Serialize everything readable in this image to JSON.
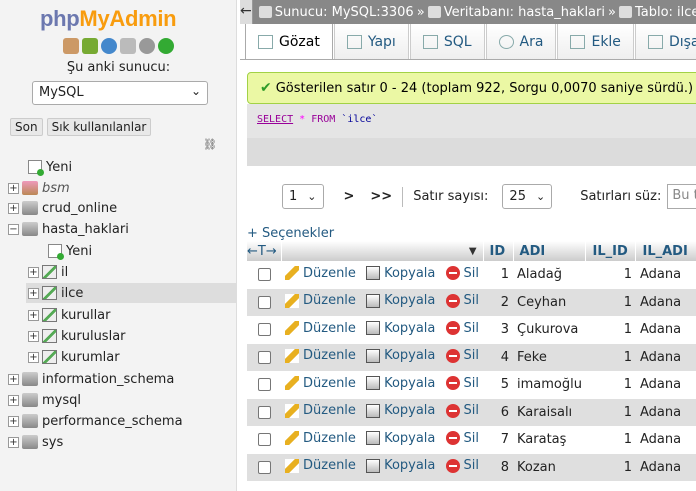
{
  "logo": {
    "php": "php",
    "myadmin": "MyAdmin"
  },
  "nav_icons": [
    "home-icon",
    "exit-icon",
    "help-icon",
    "docs-icon",
    "settings-icon",
    "reload-icon"
  ],
  "server_label": "Şu anki sunucu:",
  "server_select": "MySQL",
  "nav_buttons": {
    "recent": "Son",
    "favorites": "Sık kullanılanlar"
  },
  "tree": {
    "new": "Yeni",
    "dbs": [
      "bsm",
      "crud_online",
      "hasta_haklari"
    ],
    "hasta_haklari_children": {
      "new": "Yeni",
      "tables": [
        "il",
        "ilce",
        "kurullar",
        "kuruluslar",
        "kurumlar"
      ]
    },
    "other_dbs": [
      "information_schema",
      "mysql",
      "performance_schema",
      "sys"
    ]
  },
  "breadcrumb": {
    "server": "Sunucu: MySQL:3306",
    "database": "Veritabanı: hasta_haklari",
    "table": "Tablo: ilce",
    "sep": "»"
  },
  "tabs": [
    "Gözat",
    "Yapı",
    "SQL",
    "Ara",
    "Ekle",
    "Dışa a"
  ],
  "success_msg": "Gösterilen satır 0 - 24 (toplam 922, Sorgu 0,0070 saniye sürdü.)",
  "sql": {
    "kw": "SELECT",
    "star": "*",
    "from": "FROM",
    "table": "`ilce`"
  },
  "pager": {
    "page": "1",
    "next": ">",
    "last": ">>",
    "rows_label": "Satır sayısı:",
    "rows_value": "25",
    "filter_label": "Satırları süz:",
    "filter_placeholder": "Bu tab"
  },
  "options_link": "+ Seçenekler",
  "columns": [
    "ID",
    "ADI",
    "IL_ID",
    "IL_ADI"
  ],
  "actions": {
    "edit": "Düzenle",
    "copy": "Kopyala",
    "delete": "Sil"
  },
  "rows": [
    {
      "id": "1",
      "adi": "Aladağ",
      "il_id": "1",
      "il_adi": "Adana"
    },
    {
      "id": "2",
      "adi": "Ceyhan",
      "il_id": "1",
      "il_adi": "Adana"
    },
    {
      "id": "3",
      "adi": "Çukurova",
      "il_id": "1",
      "il_adi": "Adana"
    },
    {
      "id": "4",
      "adi": "Feke",
      "il_id": "1",
      "il_adi": "Adana"
    },
    {
      "id": "5",
      "adi": "imamoğlu",
      "il_id": "1",
      "il_adi": "Adana"
    },
    {
      "id": "6",
      "adi": "Karaisalı",
      "il_id": "1",
      "il_adi": "Adana"
    },
    {
      "id": "7",
      "adi": "Karataş",
      "il_id": "1",
      "il_adi": "Adana"
    },
    {
      "id": "8",
      "adi": "Kozan",
      "il_id": "1",
      "il_adi": "Adana"
    }
  ]
}
